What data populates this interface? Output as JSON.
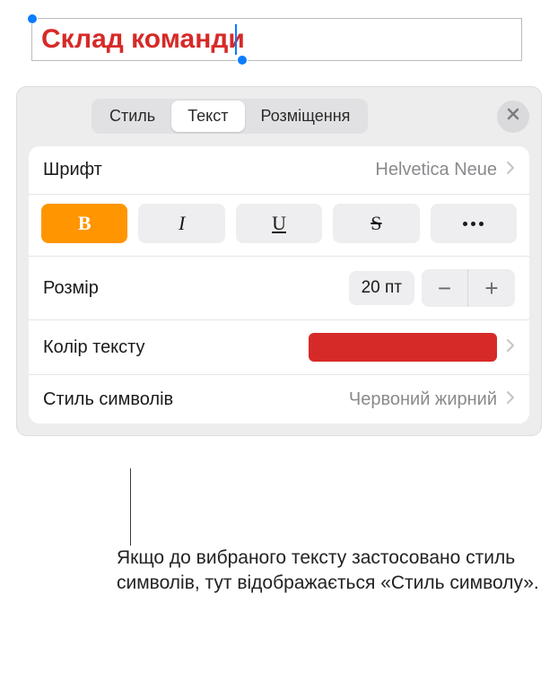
{
  "canvas": {
    "text": "Склад команди"
  },
  "tabs": {
    "style": "Стиль",
    "text": "Текст",
    "arrange": "Розміщення"
  },
  "font": {
    "label": "Шрифт",
    "value": "Helvetica Neue"
  },
  "format": {
    "bold": "B",
    "italic": "I",
    "underline": "U",
    "strike": "S"
  },
  "size": {
    "label": "Розмір",
    "value": "20 пт",
    "minus": "−",
    "plus": "+"
  },
  "color": {
    "label": "Колір тексту",
    "value": "#d62a28"
  },
  "charstyle": {
    "label": "Стиль символів",
    "value": "Червоний жирний"
  },
  "callout": "Якщо до вибраного тексту застосовано стиль символів, тут відображається «Стиль символу»."
}
